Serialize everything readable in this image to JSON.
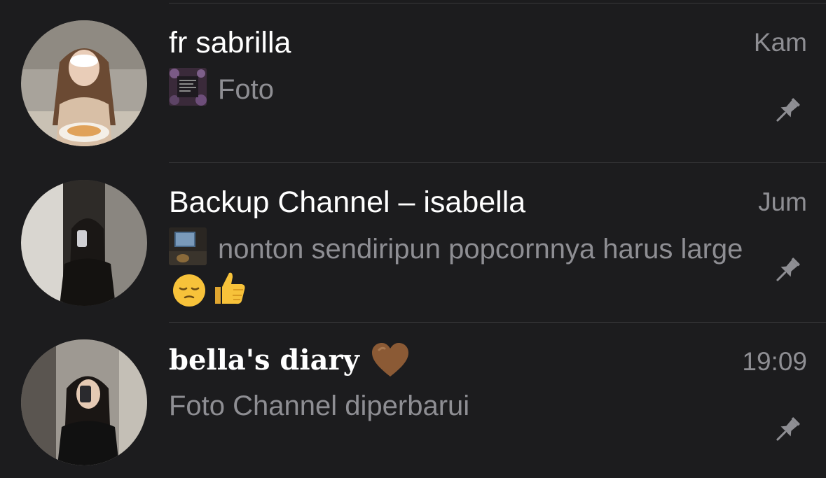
{
  "chats": [
    {
      "name": "fr sabrilla",
      "time": "Kam",
      "preview": "Foto",
      "preview_icon": "photo-thumbnail",
      "pinned": true
    },
    {
      "name": "Backup Channel – isabella",
      "time": "Jum",
      "preview": "nonton sendiripun popcornnya harus large",
      "preview_icon": "photo-thumbnail",
      "preview_emojis": [
        "pensive-face-emoji",
        "thumbs-up-emoji"
      ],
      "pinned": true
    },
    {
      "name": "bella's diary",
      "name_emoji": "brown-heart-emoji",
      "time": "19:09",
      "preview": "Foto Channel diperbarui",
      "pinned": true
    }
  ],
  "colors": {
    "background": "#1c1c1e",
    "primary_text": "#ffffff",
    "secondary_text": "#8e8e93",
    "divider": "#38383a",
    "pin": "#8e8e93"
  }
}
